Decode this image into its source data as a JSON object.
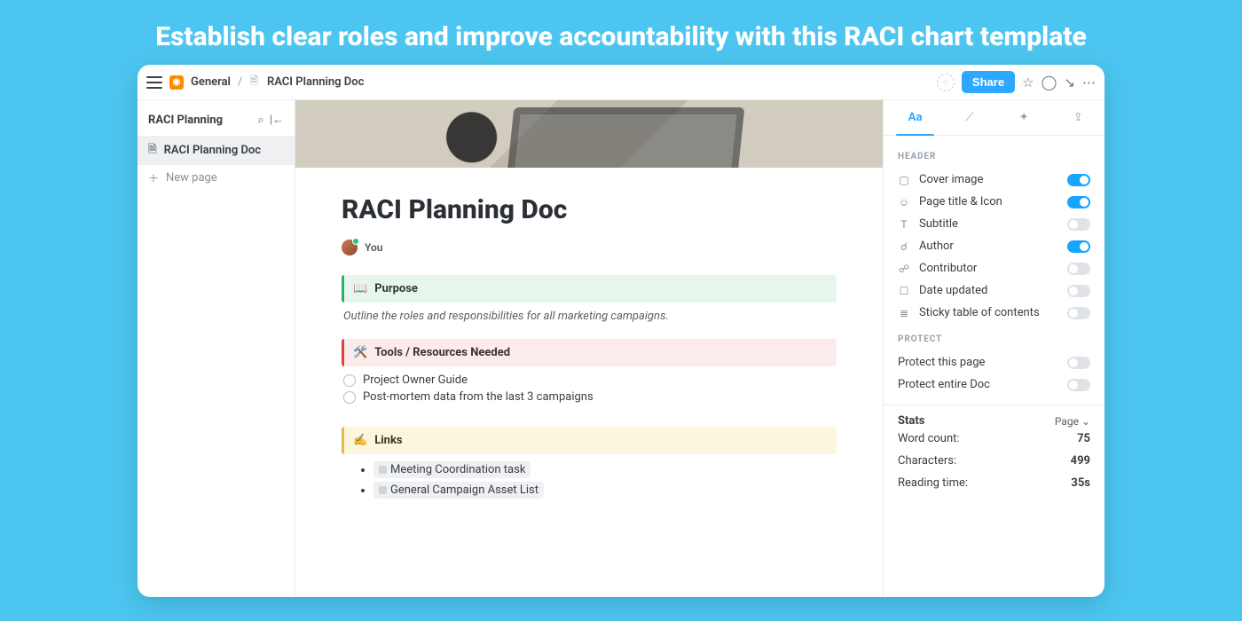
{
  "hero": "Establish clear roles and improve accountability with this RACI chart template",
  "breadcrumb": {
    "workspace": "General",
    "doc": "RACI Planning Doc"
  },
  "topbar": {
    "share": "Share"
  },
  "sidebar": {
    "title": "RACI Planning",
    "items": [
      {
        "label": "RACI Planning Doc"
      },
      {
        "label": "New page"
      }
    ]
  },
  "doc": {
    "title": "RACI Planning Doc",
    "author": "You",
    "purpose_heading": "Purpose",
    "purpose_text": "Outline the roles and responsibilities for all marketing campaigns.",
    "tools_heading": "Tools / Resources Needed",
    "tools_items": [
      "Project Owner Guide",
      "Post-mortem data from the last 3 campaigns"
    ],
    "links_heading": "Links",
    "links_items": [
      "Meeting Coordination task",
      "General Campaign Asset List"
    ]
  },
  "rpanel": {
    "tab_text": "Aa",
    "header_label": "HEADER",
    "opts": [
      {
        "icon": "▢",
        "label": "Cover image",
        "on": true
      },
      {
        "icon": "☺",
        "label": "Page title & Icon",
        "on": true
      },
      {
        "icon": "T",
        "label": "Subtitle",
        "on": false
      },
      {
        "icon": "☌",
        "label": "Author",
        "on": true
      },
      {
        "icon": "☍",
        "label": "Contributor",
        "on": false
      },
      {
        "icon": "☐",
        "label": "Date updated",
        "on": false
      },
      {
        "icon": "≣",
        "label": "Sticky table of contents",
        "on": false
      }
    ],
    "protect_label": "PROTECT",
    "protect": [
      {
        "label": "Protect this page",
        "on": false
      },
      {
        "label": "Protect entire Doc",
        "on": false
      }
    ],
    "stats_label": "Stats",
    "stats_scope": "Page",
    "stats": [
      {
        "k": "Word count:",
        "v": "75"
      },
      {
        "k": "Characters:",
        "v": "499"
      },
      {
        "k": "Reading time:",
        "v": "35s"
      }
    ]
  }
}
